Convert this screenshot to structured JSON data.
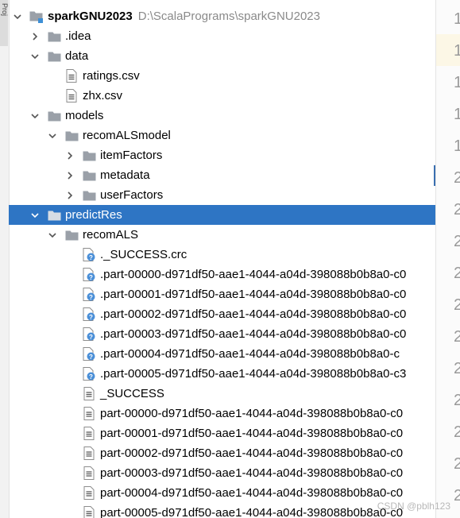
{
  "side_panel": {
    "tab_label": "Proj"
  },
  "tree": {
    "items": [
      {
        "depth": 0,
        "expanded": true,
        "icon": "module-folder-icon",
        "name": "sparkGNU2023",
        "bold": true,
        "path": "D:\\ScalaPrograms\\sparkGNU2023"
      },
      {
        "depth": 1,
        "expanded": false,
        "icon": "folder-icon",
        "name": ".idea"
      },
      {
        "depth": 1,
        "expanded": true,
        "icon": "folder-icon",
        "name": "data"
      },
      {
        "depth": 2,
        "leaf": true,
        "icon": "csv-file-icon",
        "name": "ratings.csv"
      },
      {
        "depth": 2,
        "leaf": true,
        "icon": "csv-file-icon",
        "name": "zhx.csv"
      },
      {
        "depth": 1,
        "expanded": true,
        "icon": "folder-icon",
        "name": "models"
      },
      {
        "depth": 2,
        "expanded": true,
        "icon": "folder-icon",
        "name": "recomALSmodel"
      },
      {
        "depth": 3,
        "expanded": false,
        "icon": "folder-icon",
        "name": "itemFactors"
      },
      {
        "depth": 3,
        "expanded": false,
        "icon": "folder-icon",
        "name": "metadata"
      },
      {
        "depth": 3,
        "expanded": false,
        "icon": "folder-icon",
        "name": "userFactors"
      },
      {
        "depth": 1,
        "expanded": true,
        "icon": "folder-icon",
        "name": "predictRes",
        "selected": true
      },
      {
        "depth": 2,
        "expanded": true,
        "icon": "folder-icon",
        "name": "recomALS"
      },
      {
        "depth": 3,
        "leaf": true,
        "icon": "unknown-file-icon",
        "name": "._SUCCESS.crc"
      },
      {
        "depth": 3,
        "leaf": true,
        "icon": "unknown-file-icon",
        "name": ".part-00000-d971df50-aae1-4044-a04d-398088b0b8a0-c0"
      },
      {
        "depth": 3,
        "leaf": true,
        "icon": "unknown-file-icon",
        "name": ".part-00001-d971df50-aae1-4044-a04d-398088b0b8a0-c0"
      },
      {
        "depth": 3,
        "leaf": true,
        "icon": "unknown-file-icon",
        "name": ".part-00002-d971df50-aae1-4044-a04d-398088b0b8a0-c0"
      },
      {
        "depth": 3,
        "leaf": true,
        "icon": "unknown-file-icon",
        "name": ".part-00003-d971df50-aae1-4044-a04d-398088b0b8a0-c0"
      },
      {
        "depth": 3,
        "leaf": true,
        "icon": "unknown-file-icon",
        "name": ".part-00004-d971df50-aae1-4044-a04d-398088b0b8a0-c"
      },
      {
        "depth": 3,
        "leaf": true,
        "icon": "unknown-file-icon",
        "name": ".part-00005-d971df50-aae1-4044-a04d-398088b0b8a0-c3"
      },
      {
        "depth": 3,
        "leaf": true,
        "icon": "text-file-icon",
        "name": "_SUCCESS"
      },
      {
        "depth": 3,
        "leaf": true,
        "icon": "text-file-icon",
        "name": "part-00000-d971df50-aae1-4044-a04d-398088b0b8a0-c0"
      },
      {
        "depth": 3,
        "leaf": true,
        "icon": "text-file-icon",
        "name": "part-00001-d971df50-aae1-4044-a04d-398088b0b8a0-c0"
      },
      {
        "depth": 3,
        "leaf": true,
        "icon": "text-file-icon",
        "name": "part-00002-d971df50-aae1-4044-a04d-398088b0b8a0-c0"
      },
      {
        "depth": 3,
        "leaf": true,
        "icon": "text-file-icon",
        "name": "part-00003-d971df50-aae1-4044-a04d-398088b0b8a0-c0"
      },
      {
        "depth": 3,
        "leaf": true,
        "icon": "text-file-icon",
        "name": "part-00004-d971df50-aae1-4044-a04d-398088b0b8a0-c0"
      },
      {
        "depth": 3,
        "leaf": true,
        "icon": "text-file-icon",
        "name": "part-00005-d971df50-aae1-4044-a04d-398088b0b8a0-c0"
      }
    ]
  },
  "editor_gutter": {
    "line_digits": [
      "1",
      "1",
      "1",
      "1",
      "1",
      "2",
      "2",
      "2",
      "2",
      "2",
      "2",
      "2",
      "2",
      "2",
      "2",
      "2"
    ],
    "highlighted_line_index": 1
  },
  "watermark": "CSDN @pblh123",
  "colors": {
    "selection": "#2e75c4",
    "folder": "#9aa0a8",
    "module_marker": "#3d8fd6",
    "unknown_badge": "#4a8fd8"
  }
}
